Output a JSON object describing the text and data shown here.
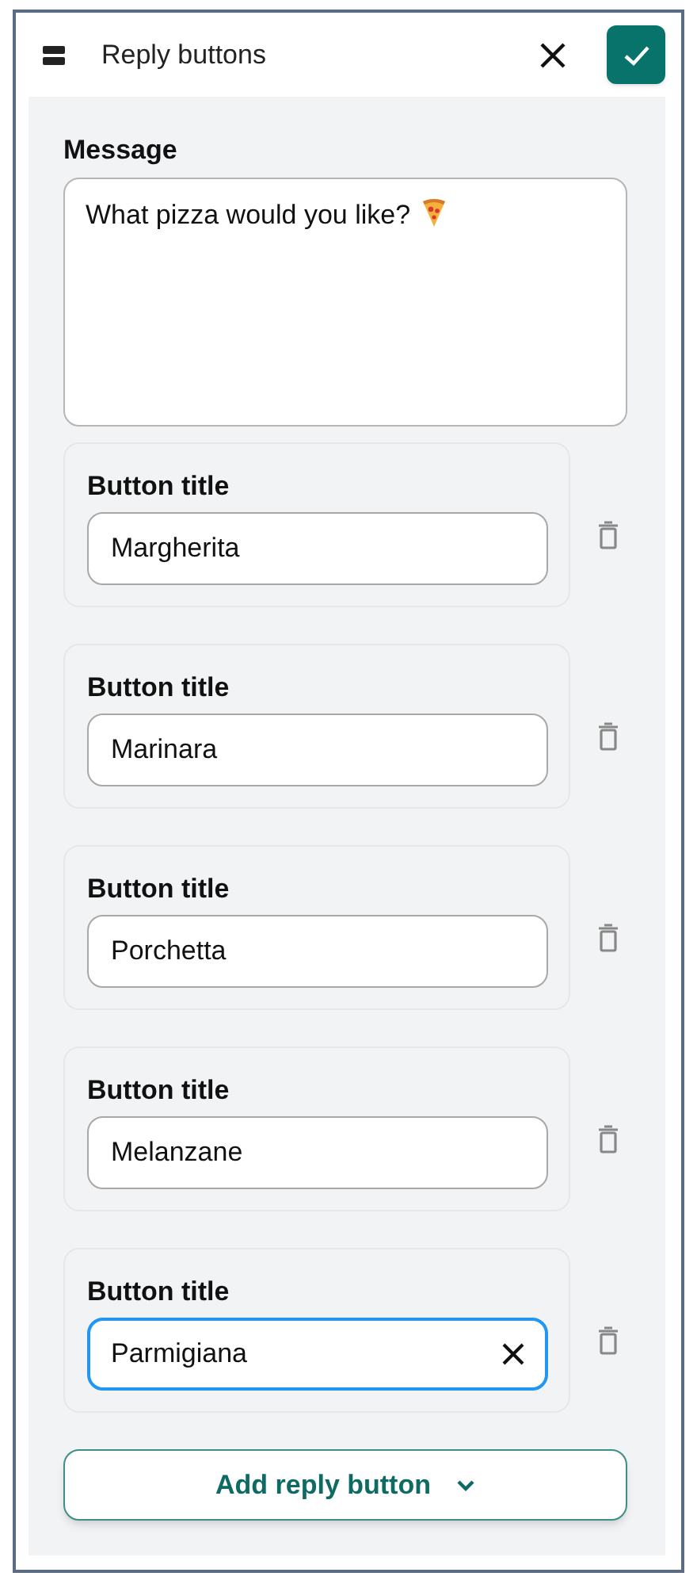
{
  "header": {
    "title": "Reply buttons"
  },
  "message": {
    "label": "Message",
    "value": "What pizza would you like?"
  },
  "reply_buttons": [
    {
      "label": "Button title",
      "value": "Margherita",
      "focused": false
    },
    {
      "label": "Button title",
      "value": "Marinara",
      "focused": false
    },
    {
      "label": "Button title",
      "value": "Porchetta",
      "focused": false
    },
    {
      "label": "Button title",
      "value": "Melanzane",
      "focused": false
    },
    {
      "label": "Button title",
      "value": "Parmigiana",
      "focused": true
    }
  ],
  "add_button": {
    "label": "Add reply button"
  }
}
